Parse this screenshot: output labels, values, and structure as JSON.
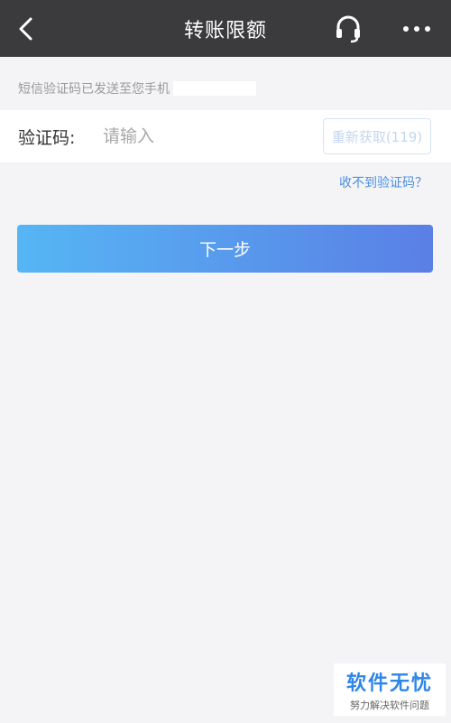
{
  "header": {
    "title": "转账限额",
    "back_icon": "chevron-left-icon",
    "support_icon": "headset-icon",
    "more_icon": "more-horizontal-icon"
  },
  "info": {
    "sms_sent_text": "短信验证码已发送至您手机"
  },
  "verification": {
    "label": "验证码:",
    "placeholder": "请输入",
    "resend_label": "重新获取(119)"
  },
  "help": {
    "not_received_label": "收不到验证码？"
  },
  "actions": {
    "next_label": "下一步"
  },
  "watermark": {
    "main": "软件无忧",
    "sub": "努力解决软件问题"
  },
  "colors": {
    "header_bg": "#3b3b3d",
    "page_bg": "#f4f4f6",
    "link": "#4a8fe0",
    "button_gradient_start": "#56b6f4",
    "button_gradient_end": "#5a7fe6"
  }
}
